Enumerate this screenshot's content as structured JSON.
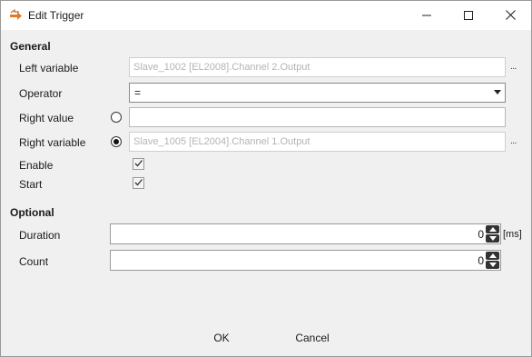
{
  "window": {
    "title": "Edit Trigger",
    "icon": "arrow-swap-icon",
    "controls": [
      "minimize",
      "maximize",
      "close"
    ]
  },
  "general": {
    "header": "General",
    "left_variable": {
      "label": "Left variable",
      "value": "Slave_1002 [EL2008].Channel 2.Output",
      "browse": "..."
    },
    "operator": {
      "label": "Operator",
      "value": "="
    },
    "right_value": {
      "label": "Right value",
      "value": "",
      "selected": false
    },
    "right_variable": {
      "label": "Right variable",
      "value": "Slave_1005 [EL2004].Channel 1.Output",
      "browse": "...",
      "selected": true
    },
    "enable": {
      "label": "Enable",
      "checked": true
    },
    "start": {
      "label": "Start",
      "checked": true
    }
  },
  "optional": {
    "header": "Optional",
    "duration": {
      "label": "Duration",
      "value": "0",
      "unit": "[ms]"
    },
    "count": {
      "label": "Count",
      "value": "0"
    }
  },
  "buttons": {
    "ok": "OK",
    "cancel": "Cancel"
  },
  "colors": {
    "accent_icon": "#e07b2a",
    "disabled_text": "#b4b4b4"
  }
}
